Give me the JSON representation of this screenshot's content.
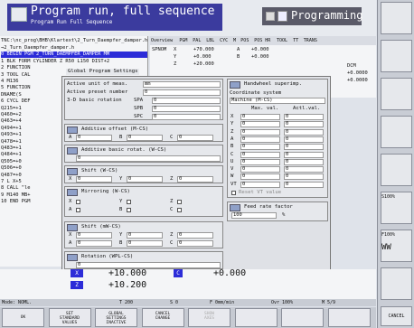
{
  "header": {
    "mode_title": "Program run, full sequence",
    "mode_subtitle": "Program Run Full Sequence",
    "prog_mode": "Programming"
  },
  "program": {
    "path": "TNC:\\nc_prog\\BHB\\Klartext\\2_Turn_Daempfer_damper.h",
    "lines": [
      "→2_Turn_Daempfer_damper.h",
      "0 BEGIN PGM 2_TURN_DAEMPFER_DAMPER MM",
      "1 BLK FORM CYLINDER Z R50 L150 DIST+2",
      "2 FUNCTION",
      "3 TOOL CAL",
      "4 M136",
      "5 FUNCTION",
      "  DNAME(S",
      "6 CYCL DEF",
      "  Q215=+1",
      "  Q460=+2",
      "  Q463=+4",
      "  Q494=+1",
      "  Q493=+1",
      "  Q478=+1",
      "  Q483=+1",
      "  Q484=+1",
      "  Q505=+0",
      "  Q506=+0",
      "  Q487=+0",
      "7 L  X+5",
      "8 CALL  \"le",
      "9 M140 MB+",
      "10 END PGM"
    ]
  },
  "status": {
    "tabs": [
      "Overview",
      "PGM",
      "PAL",
      "LBL",
      "CYC",
      "M",
      "POS",
      "POS HR",
      "TOOL",
      "TT",
      "TRANS"
    ],
    "rows": [
      {
        "ax": "SPNOM",
        "v1": "X",
        "v2": "+70.000",
        "v3": "A",
        "v4": "+0.000"
      },
      {
        "ax": "",
        "v1": "Y",
        "v2": "+0.000",
        "v3": "B",
        "v4": "+0.000"
      },
      {
        "ax": "",
        "v1": "Z",
        "v2": "+20.000",
        "v3": "",
        "v4": ""
      }
    ],
    "dcm": "DCM",
    "dcm_vals": [
      "+0.0000",
      "+0.0000"
    ]
  },
  "dialog": {
    "title": "Global Program Settings",
    "unit_label": "Active unit of meas.",
    "unit_value": "mm",
    "preset_label": "Active preset number",
    "preset_value": "0",
    "rot_label": "3-D basic rotation",
    "spa": "SPA",
    "spb": "SPB",
    "spc": "SPC",
    "zero": "0",
    "additive_offset": "Additive offset (M-CS)",
    "additive_basic_rot": "Additive basic rotat. (W-CS)",
    "shift_wcs": "Shift (W-CS)",
    "mirroring": "Mirroring (W-CS)",
    "shift_mwcs": "Shift (mW-CS)",
    "rotation": "Rotation (WPL-CS)",
    "handwheel": "Handwheel superimp.",
    "coord_sys": "Coordinate system",
    "machine": "Machine (M-CS)",
    "max_val": "Max. val.",
    "actl_val": "Actl.val.",
    "axes_a": "A",
    "axes_b": "B",
    "axes_c": "C",
    "axes_x": "X",
    "axes_y": "Y",
    "axes_z": "Z",
    "axes_u": "U",
    "axes_v": "V",
    "axes_w": "W",
    "axes_vt": "VT",
    "reset": "Reset VT value",
    "feed_label": "Feed rate factor",
    "feed_value": "100",
    "percent": "%"
  },
  "positions": {
    "x": "+10.000",
    "z": "+10.200",
    "c": "+0.000",
    "x_ax": "X",
    "z_ax": "Z",
    "c_ax": "C"
  },
  "info_line": {
    "mode": "Mode: NOML.",
    "t": "T 200",
    "s": "S 0",
    "f": "F 0mm/min",
    "ovr": "Ovr 100%",
    "m": "M 5/9"
  },
  "softkeys": [
    "OK",
    "SET\nSTANDARD\nVALUES",
    "GLOBAL\nSETTINGS\nINACTIVE",
    "CANCEL\nCHANGE",
    "SHOW\nAXES",
    "",
    "",
    "",
    "CANCEL"
  ],
  "sidebar": {
    "s_label": "S100%",
    "f_label": "F100%",
    "off_on": "OFF  ON",
    "ww": "WW"
  }
}
